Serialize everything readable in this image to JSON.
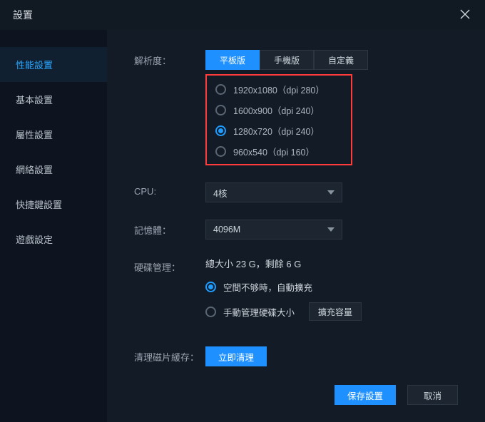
{
  "window": {
    "title": "設置"
  },
  "sidebar": {
    "items": [
      {
        "label": "性能設置",
        "active": true
      },
      {
        "label": "基本設置",
        "active": false
      },
      {
        "label": "屬性設置",
        "active": false
      },
      {
        "label": "網絡設置",
        "active": false
      },
      {
        "label": "快捷鍵設置",
        "active": false
      },
      {
        "label": "遊戲設定",
        "active": false
      }
    ]
  },
  "resolution": {
    "label": "解析度：",
    "tabs": [
      {
        "label": "平板版",
        "active": true
      },
      {
        "label": "手機版",
        "active": false
      },
      {
        "label": "自定義",
        "active": false
      }
    ],
    "options": [
      {
        "label": "1920x1080（dpi 280）",
        "checked": false
      },
      {
        "label": "1600x900（dpi 240）",
        "checked": false
      },
      {
        "label": "1280x720（dpi 240）",
        "checked": true
      },
      {
        "label": "960x540（dpi 160）",
        "checked": false
      }
    ]
  },
  "cpu": {
    "label": "CPU:",
    "value": "4核"
  },
  "memory": {
    "label": "記憶體：",
    "value": "4096M"
  },
  "disk": {
    "label": "硬碟管理：",
    "status": "總大小 23 G，剩餘 6 G",
    "auto": {
      "label": "空間不够時，自動擴充",
      "checked": true
    },
    "manual": {
      "label": "手動管理硬碟大小",
      "checked": false,
      "button": "擴充容量"
    }
  },
  "cache": {
    "label": "清理磁片緩存：",
    "button": "立即清理"
  },
  "footer": {
    "save": "保存設置",
    "cancel": "取消"
  }
}
